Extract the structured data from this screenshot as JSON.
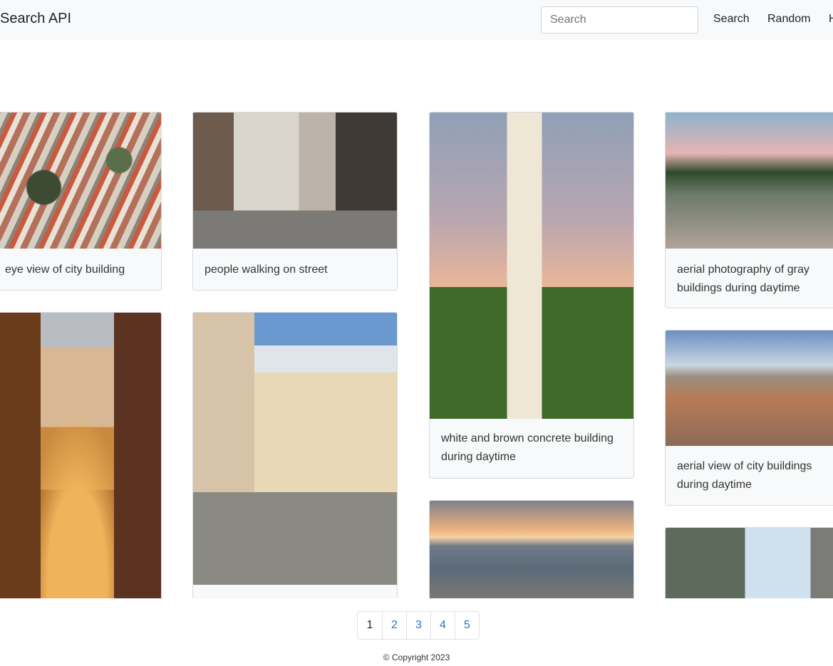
{
  "navbar": {
    "brand": "Search API",
    "search_placeholder": "Search",
    "links": [
      "Search",
      "Random",
      "H"
    ]
  },
  "cards": [
    {
      "caption": "eye view of city building"
    },
    {
      "caption": "people walking on street"
    },
    {
      "caption": "white and brown concrete building during daytime"
    },
    {
      "caption": "aerial photography of gray buildings during daytime"
    },
    {
      "caption": "aerial view of city buildings during daytime"
    }
  ],
  "pagination": {
    "pages": [
      "1",
      "2",
      "3",
      "4",
      "5"
    ],
    "active": "1"
  },
  "footer": {
    "copyright": "© Copyright 2023"
  }
}
